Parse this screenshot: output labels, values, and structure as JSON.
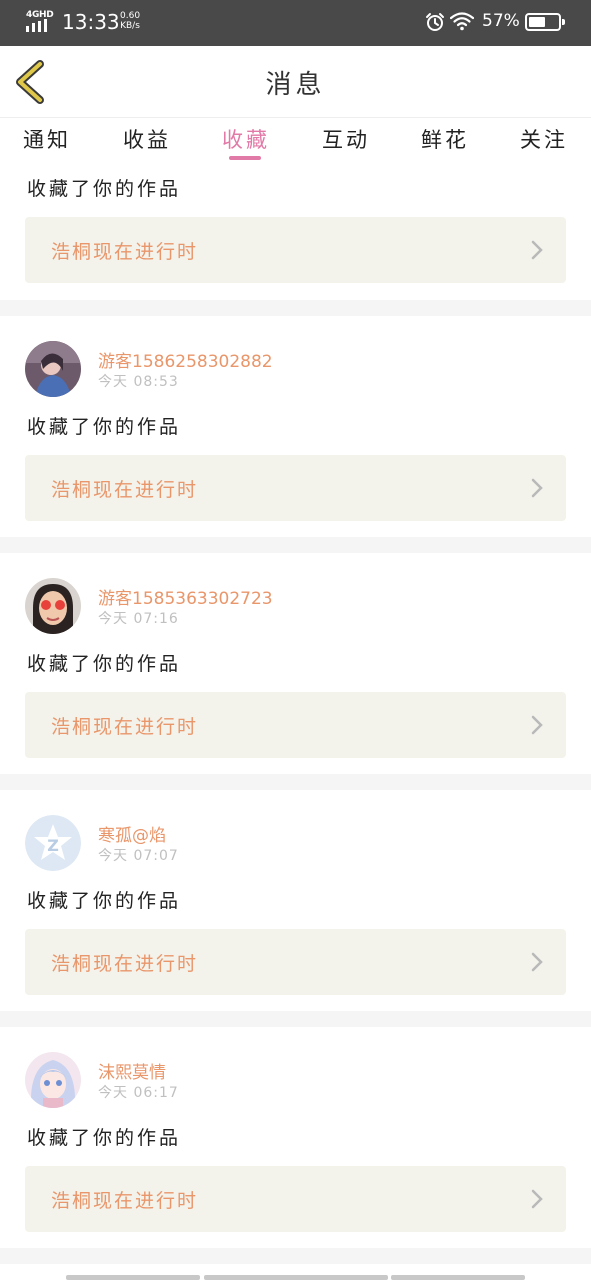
{
  "status_bar": {
    "network": "4GHD",
    "time": "13:33",
    "speed_value": "0.60",
    "speed_unit": "KB/s",
    "battery_percent": "57%",
    "battery_level": 0.57,
    "icons": [
      "signal-icon",
      "alarm-icon",
      "wifi-icon",
      "battery-icon"
    ]
  },
  "header": {
    "title": "消息",
    "back_icon": "chevron-left-icon",
    "accent_color": "#e0c84a"
  },
  "tabs": [
    {
      "label": "通知",
      "active": false
    },
    {
      "label": "收益",
      "active": false
    },
    {
      "label": "收藏",
      "active": true
    },
    {
      "label": "互动",
      "active": false
    },
    {
      "label": "鲜花",
      "active": false
    },
    {
      "label": "关注",
      "active": false
    }
  ],
  "colors": {
    "active_tab": "#e27aa8",
    "username": "#e9966a",
    "work_title": "#e9966a",
    "card_bg": "#f3f3ec",
    "divider": "#f6f5f5"
  },
  "feed": {
    "items": [
      {
        "partial": true,
        "action": "收藏了你的作品",
        "work_title": "浩桐现在进行时"
      },
      {
        "username": "游客1586258302882",
        "time": "今天 08:53",
        "avatar": "avatar-photo-1",
        "action": "收藏了你的作品",
        "work_title": "浩桐现在进行时"
      },
      {
        "username": "游客1585363302723",
        "time": "今天 07:16",
        "avatar": "avatar-photo-2",
        "action": "收藏了你的作品",
        "work_title": "浩桐现在进行时"
      },
      {
        "username": "寒孤@焰",
        "time": "今天 07:07",
        "avatar": "default-avatar-icon",
        "action": "收藏了你的作品",
        "work_title": "浩桐现在进行时"
      },
      {
        "username": "沫熙莫情",
        "time": "今天 06:17",
        "avatar": "avatar-anime-girl",
        "action": "收藏了你的作品",
        "work_title": "浩桐现在进行时"
      }
    ]
  }
}
